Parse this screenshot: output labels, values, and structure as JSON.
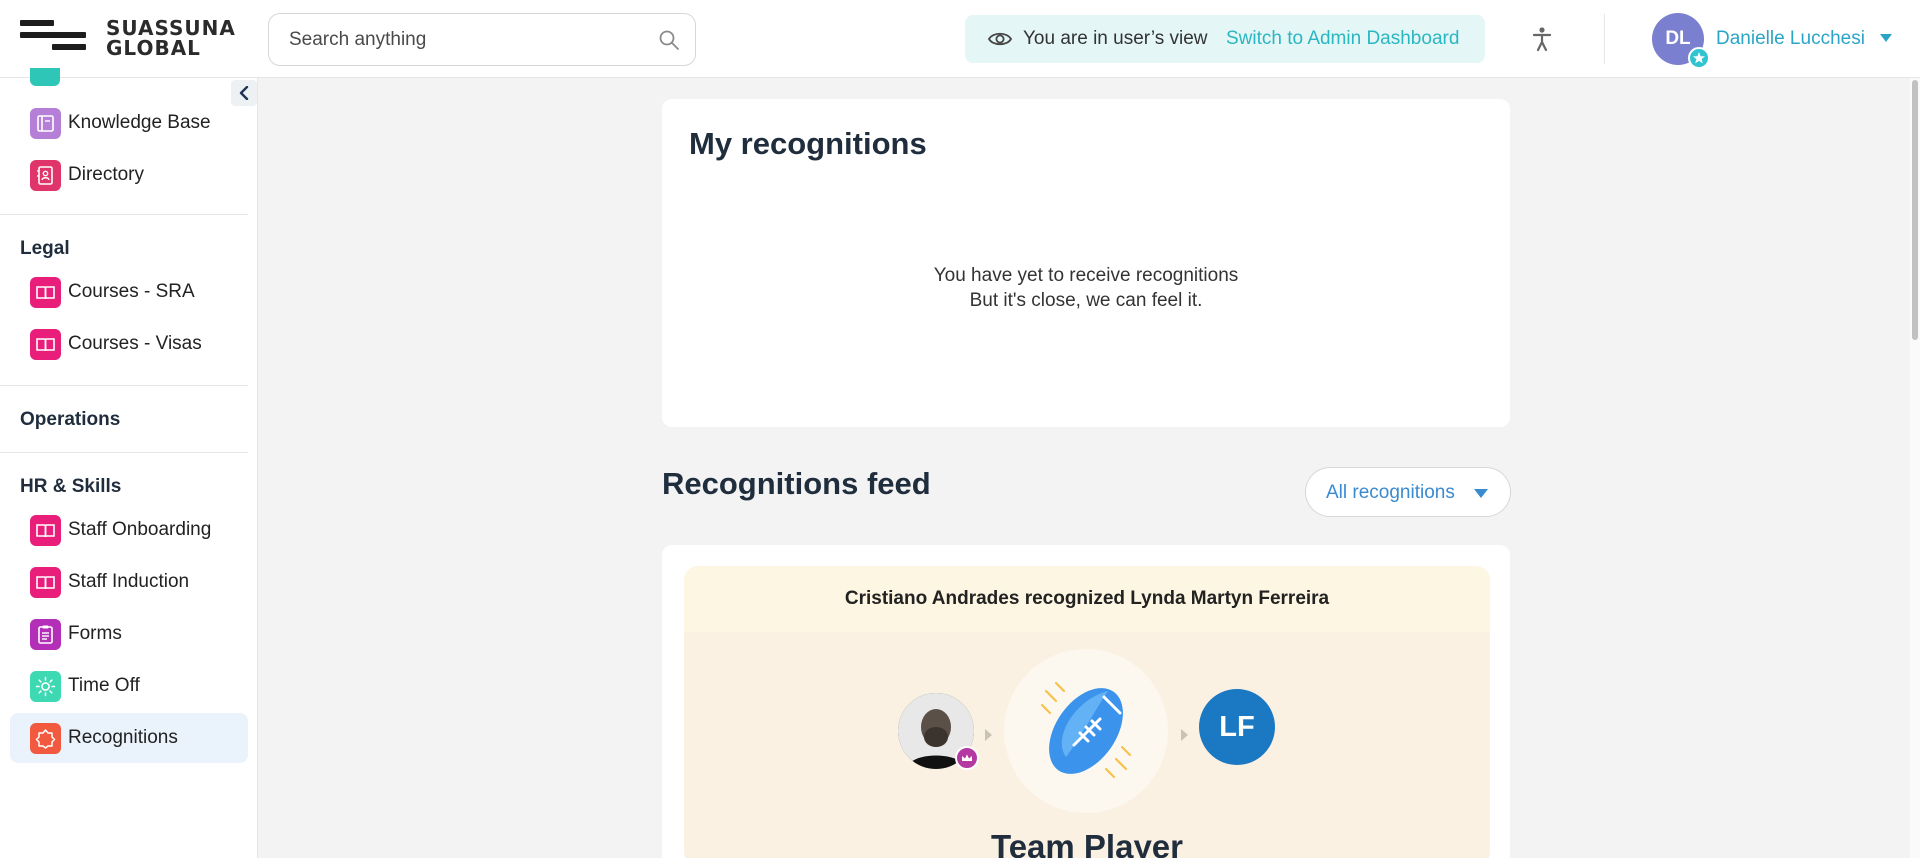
{
  "header": {
    "brand_line1": "SUASSUNA",
    "brand_line2": "GLOBAL",
    "search_placeholder": "Search anything",
    "view_message": "You are in user’s view",
    "switch_label": "Switch to Admin Dashboard",
    "user_initials": "DL",
    "user_name": "Danielle Lucchesi"
  },
  "sidebar": {
    "top_items": [
      {
        "label": "Knowledge Base",
        "icon": "book-icon",
        "color": "#b57fd8"
      },
      {
        "label": "Directory",
        "icon": "directory-icon",
        "color": "#e0356b"
      }
    ],
    "sections": [
      {
        "title": "Legal",
        "items": [
          {
            "label": "Courses - SRA",
            "icon": "open-book-icon",
            "color": "#e91e7a"
          },
          {
            "label": "Courses - Visas",
            "icon": "open-book-icon",
            "color": "#e91e7a"
          }
        ]
      },
      {
        "title": "Operations",
        "items": []
      },
      {
        "title": "HR & Skills",
        "items": [
          {
            "label": "Staff Onboarding",
            "icon": "open-book-icon",
            "color": "#e91e7a"
          },
          {
            "label": "Staff Induction",
            "icon": "open-book-icon",
            "color": "#e91e7a"
          },
          {
            "label": "Forms",
            "icon": "clipboard-icon",
            "color": "#b42fb8"
          },
          {
            "label": "Time Off",
            "icon": "sun-icon",
            "color": "#3dd9b3"
          },
          {
            "label": "Recognitions",
            "icon": "recognition-badge-icon",
            "color": "#f15a3f",
            "active": true
          }
        ]
      }
    ]
  },
  "my_recognitions": {
    "title": "My recognitions",
    "empty_line1": "You have yet to receive recognitions",
    "empty_line2": "But it's close, we can feel it."
  },
  "feed": {
    "title": "Recognitions feed",
    "filter_label": "All recognitions",
    "items": [
      {
        "headline": "Cristiano Andrades recognized Lynda Martyn Ferreira",
        "receiver_initials": "LF",
        "award": "Team Player",
        "badge_icon": "football-icon"
      }
    ]
  }
}
